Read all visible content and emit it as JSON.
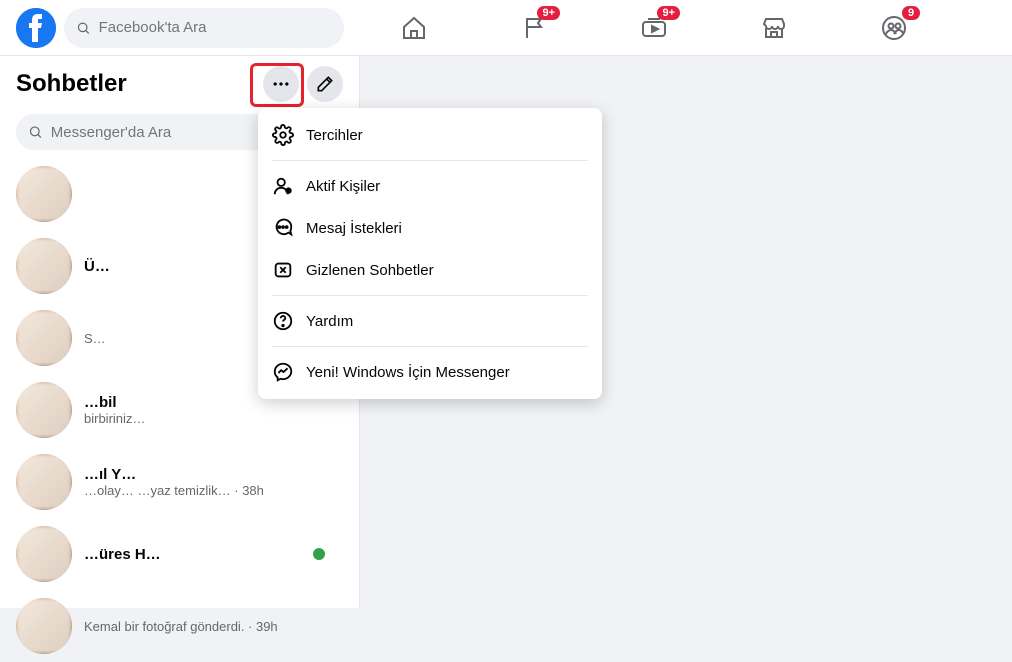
{
  "topnav": {
    "search_placeholder": "Facebook'ta Ara",
    "badges": {
      "flag": "9+",
      "watch": "9+",
      "groups": "9"
    }
  },
  "sidebar": {
    "title": "Sohbetler",
    "search_placeholder": "Messenger'da Ara",
    "chats": [
      {
        "name": "",
        "sub": ""
      },
      {
        "name": "Ü…",
        "sub": ""
      },
      {
        "name": "",
        "sub": "S…"
      },
      {
        "name": "…bil",
        "sub": "birbiriniz…"
      },
      {
        "name": "…ıl Y…",
        "sub": "…olay… …yaz temizlik… · 38h"
      },
      {
        "name": "…üres H…",
        "sub": ""
      },
      {
        "name": "",
        "sub": "Kemal bir fotoğraf gönderdi. · 39h"
      }
    ]
  },
  "dropdown": {
    "preferences": "Tercihler",
    "active": "Aktif Kişiler",
    "requests": "Mesaj İstekleri",
    "hidden": "Gizlenen Sohbetler",
    "help": "Yardım",
    "windows": "Yeni! Windows İçin Messenger"
  }
}
